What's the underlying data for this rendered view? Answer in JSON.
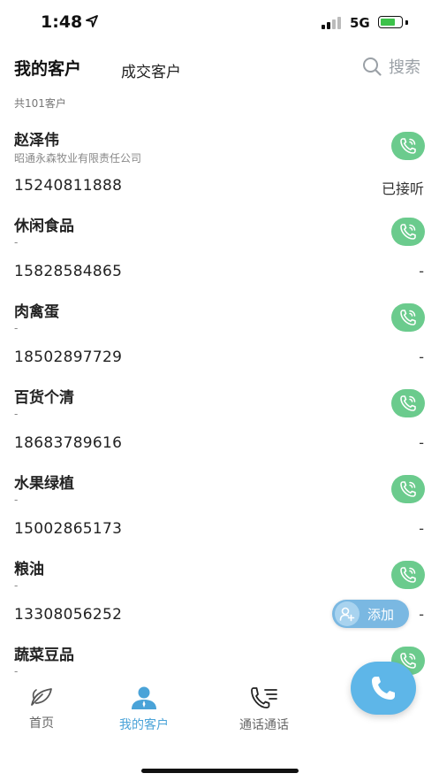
{
  "status_bar": {
    "time": "1:48",
    "network": "5G"
  },
  "header": {
    "tab_mine": "我的客户",
    "tab_deal": "成交客户",
    "search_label": "搜索"
  },
  "total": "共101客户",
  "customers": [
    {
      "name": "赵泽伟",
      "company": "昭通永森牧业有限责任公司",
      "phone": "15240811888",
      "status": "已接听"
    },
    {
      "name": "休闲食品",
      "company": "-",
      "phone": "15828584865",
      "status": "-"
    },
    {
      "name": "肉禽蛋",
      "company": "-",
      "phone": "18502897729",
      "status": "-"
    },
    {
      "name": "百货个清",
      "company": "-",
      "phone": "18683789616",
      "status": "-"
    },
    {
      "name": "水果绿植",
      "company": "-",
      "phone": "15002865173",
      "status": "-"
    },
    {
      "name": "粮油",
      "company": "-",
      "phone": "13308056252",
      "status": "-"
    },
    {
      "name": "蔬菜豆品",
      "company": "-",
      "phone": "",
      "status": ""
    }
  ],
  "add_button": {
    "label": "添加"
  },
  "bottom_nav": {
    "home": "首页",
    "my_customers": "我的客户",
    "calls": "通话通话"
  },
  "colors": {
    "accent": "#5eb6e8",
    "call_green": "#6bcb8d",
    "active_nav": "#4aa3d8",
    "inactive_nav": "#666666"
  },
  "icons": {
    "call": "phone-ring-icon",
    "search": "search-icon",
    "add": "add-user-icon",
    "dial": "phone-icon",
    "home": "leaf-icon",
    "customer": "user-icon",
    "call_list": "call-list-icon"
  }
}
